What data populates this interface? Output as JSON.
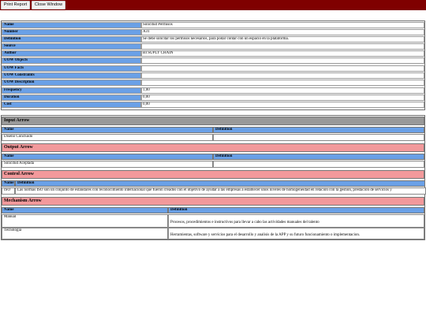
{
  "toolbar": {
    "print_label": "Print Report",
    "close_label": "Close Window"
  },
  "properties": [
    {
      "label": "Name",
      "value": "Solicitud Permisos"
    },
    {
      "label": "Number",
      "value": "A31"
    },
    {
      "label": "Definition",
      "value": "Se debe solicitar los permisos necesarios, para podar contar con un espacio en la plataforma."
    },
    {
      "label": "Source",
      "value": ""
    },
    {
      "label": "Author",
      "value": "BI SUPLY CHAIN"
    },
    {
      "label": "UOW Objects",
      "value": ""
    },
    {
      "label": "UOW Facts",
      "value": ""
    },
    {
      "label": "UOW Constraints",
      "value": ""
    },
    {
      "label": "UOW Description",
      "value": ""
    },
    {
      "label": "Frequency",
      "value": "1,00"
    },
    {
      "label": "Duration",
      "value": "0,00"
    },
    {
      "label": "Cost",
      "value": "0,00"
    }
  ],
  "input_arrow": {
    "title": "Input Arrow",
    "headers": [
      "Name",
      "Definition"
    ],
    "rows": [
      {
        "name": "Diseno Concluido",
        "definition": ""
      }
    ]
  },
  "output_arrow": {
    "title": "Output Arrow",
    "headers": [
      "Name",
      "Definition"
    ],
    "rows": [
      {
        "name": "Solicitud Aceptada",
        "definition": ""
      }
    ]
  },
  "control_arrow": {
    "title": "Control Arrow",
    "headers": [
      "Name",
      "Definition"
    ],
    "rows": [
      {
        "name": "ISO",
        "definition": "Las normas ISO son un conjunto de estándares con reconocimiento internacional que fueron creados con el objetivo de ayudar a las empresas a establecer unos niveles de homogeneidad en relación con la gestión, prestación de servicios y"
      }
    ]
  },
  "mechanism_arrow": {
    "title": "Mechanism Arrow",
    "headers": [
      "Name",
      "Definition"
    ],
    "rows": [
      {
        "name": "Manual",
        "definition": "Procesos, procedimientos e instructivos para llevar a cabo las actividades manuales del talento"
      },
      {
        "name": "Tecnologia",
        "definition": "Herramientas, software y servicios para el desarrollo y analisis de la APP y su futuro funcionamiento o implementacion."
      }
    ]
  }
}
